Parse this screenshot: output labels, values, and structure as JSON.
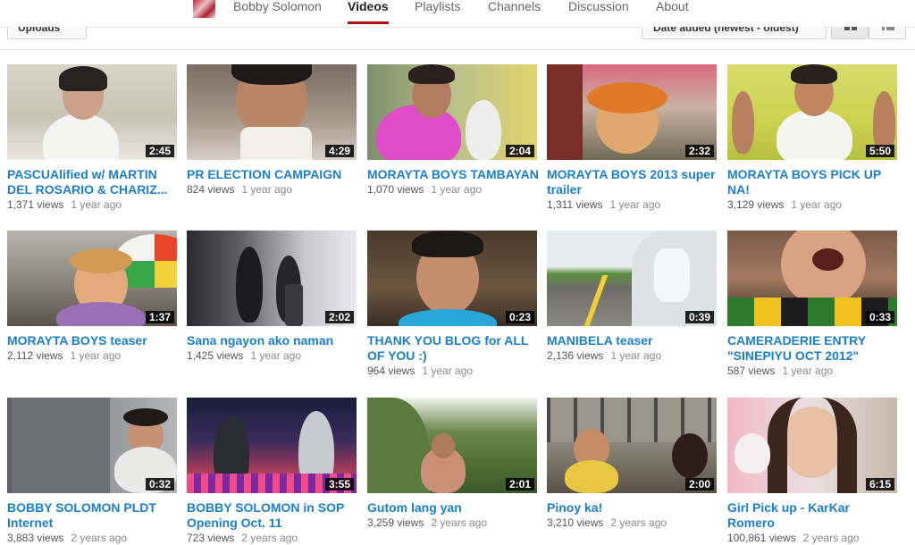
{
  "header": {
    "tabs": [
      {
        "label": "Bobby Solomon",
        "active": false
      },
      {
        "label": "Videos",
        "active": true
      },
      {
        "label": "Playlists",
        "active": false
      },
      {
        "label": "Channels",
        "active": false
      },
      {
        "label": "Discussion",
        "active": false
      },
      {
        "label": "About",
        "active": false
      }
    ],
    "accent_color": "#b31217"
  },
  "controls": {
    "uploads_label": "Uploads",
    "sort_label": "Date added (newest - oldest)",
    "grid_view_icon": "grid-view-icon",
    "list_view_icon": "list-view-icon"
  },
  "videos": [
    {
      "title": "PASCUAlified w/ MARTIN DEL ROSARIO & CHARIZ...",
      "views": "1,371 views",
      "ago": "1 year ago",
      "duration": "2:45"
    },
    {
      "title": "PR ELECTION CAMPAIGN",
      "views": "824 views",
      "ago": "1 year ago",
      "duration": "4:29"
    },
    {
      "title": "MORAYTA BOYS TAMBAYAN",
      "views": "1,070 views",
      "ago": "1 year ago",
      "duration": "2:04"
    },
    {
      "title": "MORAYTA BOYS 2013 super trailer",
      "views": "1,311 views",
      "ago": "1 year ago",
      "duration": "2:32"
    },
    {
      "title": "MORAYTA BOYS PICK UP NA!",
      "views": "3,129 views",
      "ago": "1 year ago",
      "duration": "5:50"
    },
    {
      "title": "MORAYTA BOYS teaser",
      "views": "2,112 views",
      "ago": "1 year ago",
      "duration": "1:37"
    },
    {
      "title": "Sana ngayon ako naman",
      "views": "1,425 views",
      "ago": "1 year ago",
      "duration": "2:02"
    },
    {
      "title": "THANK YOU BLOG for ALL OF YOU :)",
      "views": "964 views",
      "ago": "1 year ago",
      "duration": "0:23"
    },
    {
      "title": "MANIBELA teaser",
      "views": "2,136 views",
      "ago": "1 year ago",
      "duration": "0:39"
    },
    {
      "title": "CAMERADERIE ENTRY \"SINEPIYU OCT 2012\"",
      "views": "587 views",
      "ago": "1 year ago",
      "duration": "0:33"
    },
    {
      "title": "BOBBY SOLOMON PLDT Internet",
      "views": "3,883 views",
      "ago": "2 years ago",
      "duration": "0:32"
    },
    {
      "title": "BOBBY SOLOMON in SOP Opening Oct. 11",
      "views": "723 views",
      "ago": "2 years ago",
      "duration": "3:55"
    },
    {
      "title": "Gutom lang yan",
      "views": "3,259 views",
      "ago": "2 years ago",
      "duration": "2:01"
    },
    {
      "title": "Pinoy ka!",
      "views": "3,210 views",
      "ago": "2 years ago",
      "duration": "2:00"
    },
    {
      "title": "Girl Pick up - KarKar Romero",
      "views": "100,861 views",
      "ago": "2 years ago",
      "duration": "6:15"
    }
  ],
  "colors": {
    "title_link": "#1b7fcc",
    "meta_text": "#555555"
  }
}
